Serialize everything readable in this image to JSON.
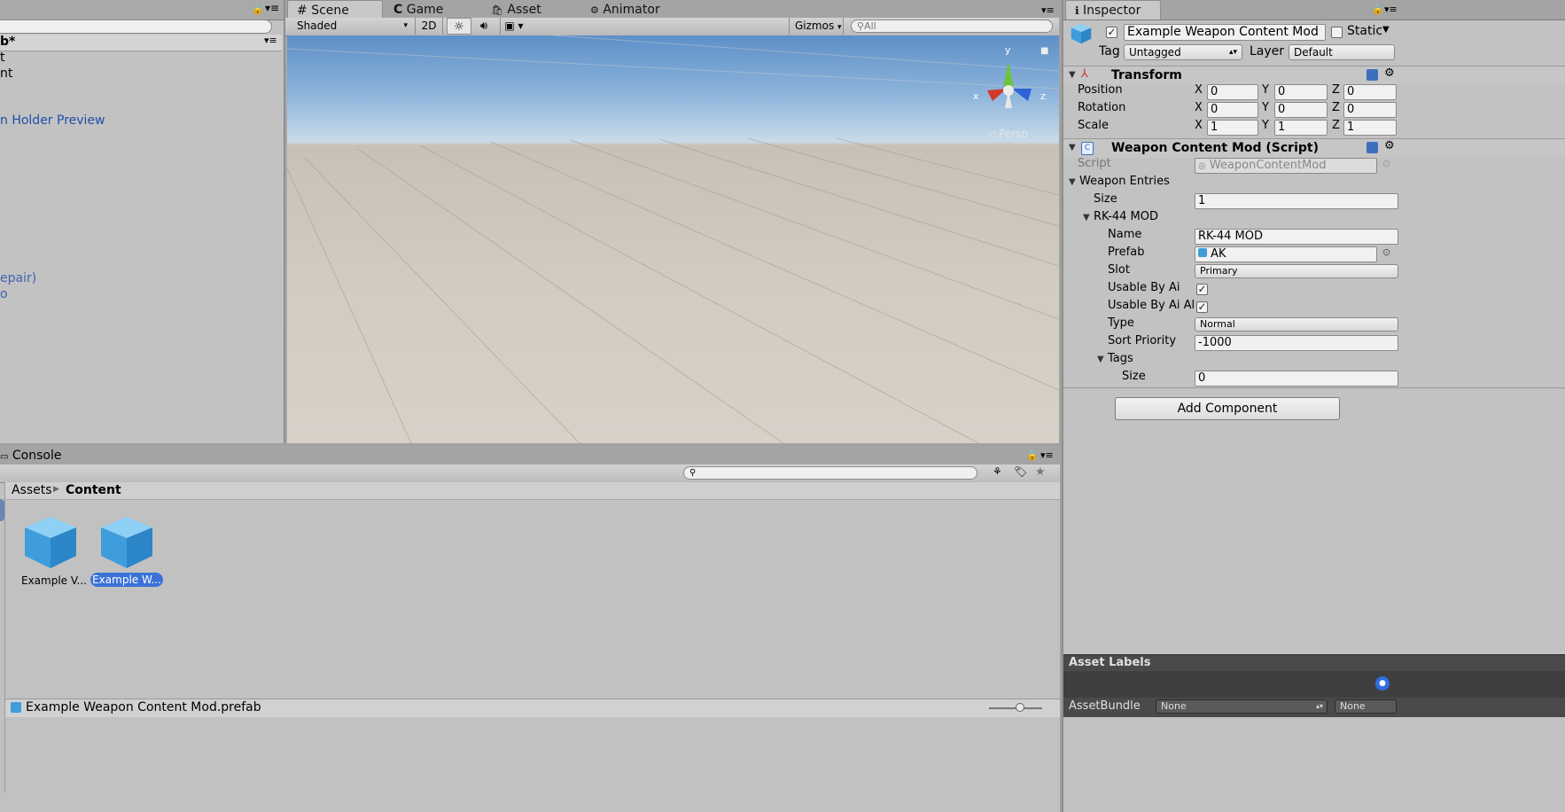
{
  "hierarchy": {
    "title_fragment": "b*",
    "rows": [
      "t",
      "nt",
      "n Holder Preview",
      "epair)",
      "o"
    ]
  },
  "scene": {
    "tabs": [
      "Scene",
      "Game",
      "Asset Store",
      "Animator"
    ],
    "shading_mode": "Shaded",
    "btn_2d": "2D",
    "gizmos_label": "Gizmos",
    "search_placeholder": "All",
    "persp_label": "Persp",
    "axis_labels": {
      "x": "x",
      "y": "y",
      "z": "z"
    }
  },
  "console": {
    "tab_label": "Console"
  },
  "project": {
    "breadcrumb_root": "Assets",
    "breadcrumb_current": "Content",
    "assets": [
      {
        "label": "Example V..."
      },
      {
        "label": "Example W...",
        "selected": true
      }
    ],
    "status_file": "Example Weapon Content Mod.prefab"
  },
  "inspector": {
    "tab_label": "Inspector",
    "object_name": "Example Weapon Content Mod",
    "static_label": "Static",
    "tag_label": "Tag",
    "tag_value": "Untagged",
    "layer_label": "Layer",
    "layer_value": "Default",
    "transform": {
      "title": "Transform",
      "rows": [
        {
          "label": "Position",
          "x": "0",
          "y": "0",
          "z": "0"
        },
        {
          "label": "Rotation",
          "x": "0",
          "y": "0",
          "z": "0"
        },
        {
          "label": "Scale",
          "x": "1",
          "y": "1",
          "z": "1"
        }
      ],
      "axis": {
        "x": "X",
        "y": "Y",
        "z": "Z"
      }
    },
    "script_component": {
      "title": "Weapon Content Mod (Script)",
      "script_label": "Script",
      "script_value": "WeaponContentMod",
      "weapon_entries_label": "Weapon Entries",
      "size_label": "Size",
      "size_value": "1",
      "entry_title": "RK-44 MOD",
      "name_label": "Name",
      "name_value": "RK-44 MOD",
      "prefab_label": "Prefab",
      "prefab_value": "AK",
      "slot_label": "Slot",
      "slot_value": "Primary",
      "usable_by_ai_label": "Usable By Ai",
      "usable_by_ai_checked": true,
      "usable_by_ai_al_label": "Usable By Ai Al",
      "usable_by_ai_al_checked": true,
      "type_label": "Type",
      "type_value": "Normal",
      "sort_priority_label": "Sort Priority",
      "sort_priority_value": "-1000",
      "tags_label": "Tags",
      "tags_size_label": "Size",
      "tags_size_value": "0"
    },
    "add_component_label": "Add Component",
    "asset_labels_title": "Asset Labels",
    "assetbundle_label": "AssetBundle",
    "assetbundle_value": "None",
    "assetbundle_variant": "None"
  },
  "colors": {
    "selection_blue": "#3a72d8",
    "link_blue": "#1f4fa8",
    "sky_top": "#5d8fc7",
    "floor": "#cfc7bd"
  }
}
